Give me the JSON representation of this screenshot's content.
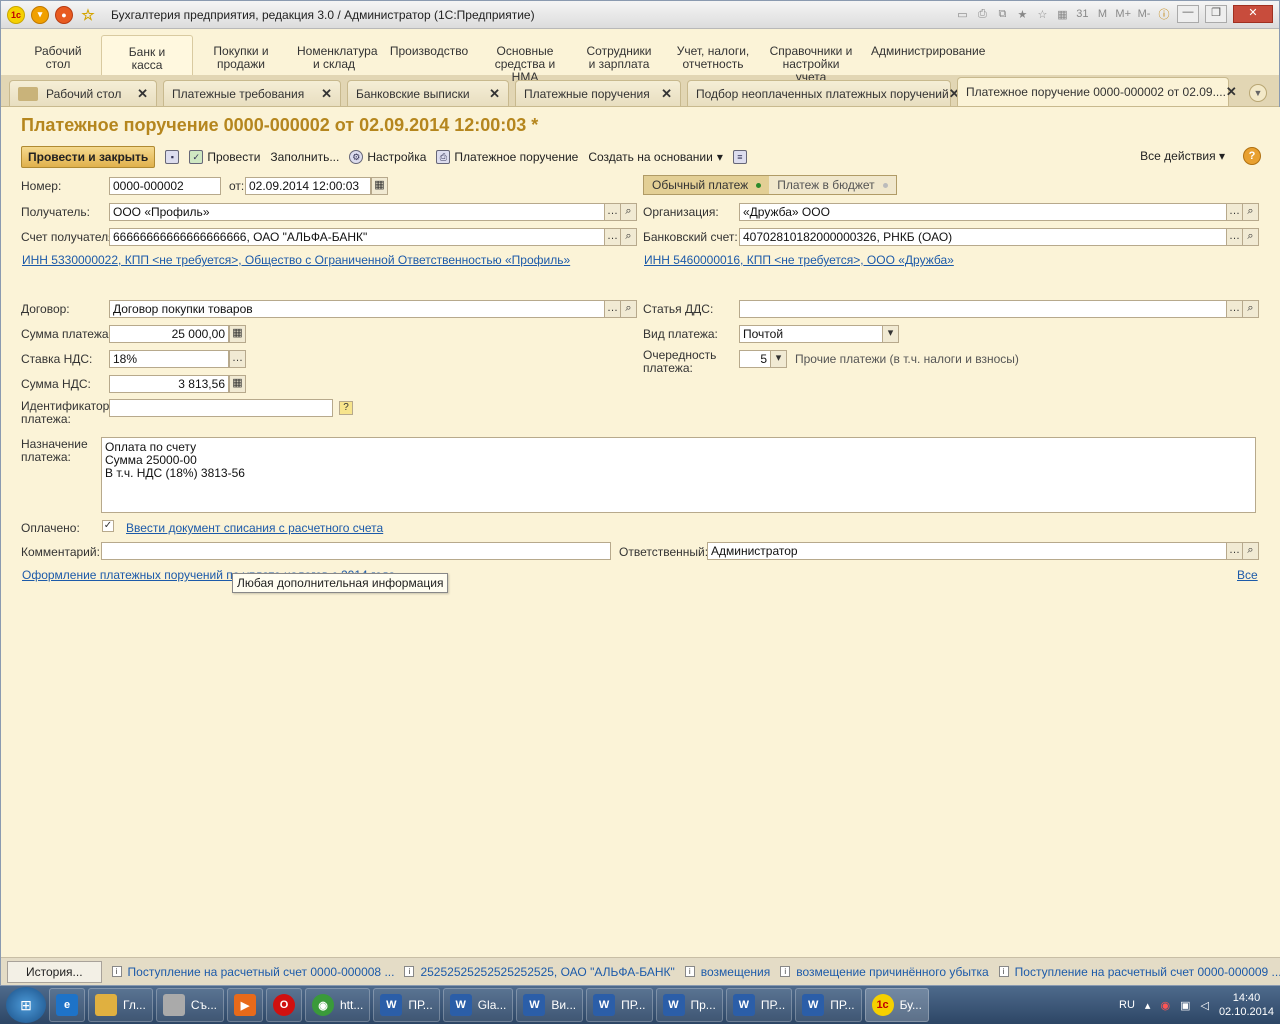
{
  "titlebar": {
    "title": "Бухгалтерия предприятия, редакция 3.0 / Администратор  (1С:Предприятие)",
    "right_icons": [
      "M",
      "M+",
      "M-"
    ]
  },
  "sections": [
    {
      "label": "Рабочий\nстол"
    },
    {
      "label": "Банк и\nкасса"
    },
    {
      "label": "Покупки и\nпродажи"
    },
    {
      "label": "Номенклатура\nи склад"
    },
    {
      "label": "Производство"
    },
    {
      "label": "Основные\nсредства и НМА"
    },
    {
      "label": "Сотрудники\nи зарплата"
    },
    {
      "label": "Учет, налоги,\nотчетность"
    },
    {
      "label": "Справочники и\nнастройки учета"
    },
    {
      "label": "Администрирование"
    }
  ],
  "tabs": [
    {
      "label": "Рабочий стол"
    },
    {
      "label": "Платежные требования"
    },
    {
      "label": "Банковские выписки"
    },
    {
      "label": "Платежные поручения"
    },
    {
      "label": "Подбор неоплаченных платежных поручений"
    },
    {
      "label": "Платежное поручение 0000-000002 от 02.09...."
    }
  ],
  "doc": {
    "title": "Платежное поручение 0000-000002 от 02.09.2014 12:00:03 *"
  },
  "toolbar": {
    "post_close": "Провести и закрыть",
    "post": "Провести",
    "fill": "Заполнить...",
    "settings": "Настройка",
    "print": "Платежное поручение",
    "create_based": "Создать на основании",
    "all_actions": "Все действия",
    "help": "?"
  },
  "fields": {
    "number_label": "Номер:",
    "number": "0000-000002",
    "date_label": "от:",
    "date": "02.09.2014 12:00:03",
    "recipient_label": "Получатель:",
    "recipient": "ООО «Профиль»",
    "recipient_acc_label": "Счет получателя:",
    "recipient_acc": "66666666666666666666, ОАО \"АЛЬФА-БАНК\"",
    "recipient_inn": "ИНН 5330000022, КПП <не требуется>, Общество с Ограниченной Ответственностью «Профиль»",
    "org_label": "Организация:",
    "org": "«Дружба» ООО",
    "bank_acc_label": "Банковский счет:",
    "bank_acc": "40702810182000000326, РНКБ (ОАО)",
    "org_inn": "ИНН 5460000016, КПП <не требуется>, ООО «Дружба»",
    "contract_label": "Договор:",
    "contract": "Договор покупки товаров",
    "dds_label": "Статья ДДС:",
    "dds": "",
    "sum_label": "Сумма платежа:",
    "sum": "25 000,00",
    "vat_rate_label": "Ставка НДС:",
    "vat_rate": "18%",
    "vat_sum_label": "Сумма НДС:",
    "vat_sum": "3 813,56",
    "pay_type_label": "Вид платежа:",
    "pay_type": "Почтой",
    "priority_label": "Очередность\nплатежа:",
    "priority": "5",
    "priority_desc": "Прочие платежи (в т.ч. налоги и взносы)",
    "pay_id_label": "Идентификатор\nплатежа:",
    "pay_id": "",
    "purpose_label": "Назначение\nплатежа:",
    "purpose": "Оплата по счету\nСумма 25000-00\nВ т.ч. НДС  (18%) 3813-56",
    "paid_label": "Оплачено:",
    "paid_link": "Ввести документ списания с расчетного счета",
    "comment_label": "Комментарий:",
    "comment": "",
    "responsible_label": "Ответственный:",
    "responsible": "Администратор",
    "bottom_link": "Оформление платежных поручений по уплате налогов с 2014 года",
    "all_link": "Все",
    "tooltip": "Любая дополнительная информация"
  },
  "toggle": {
    "normal": "Обычный платеж",
    "budget": "Платеж в бюджет"
  },
  "statusbar": {
    "history": "История...",
    "items": [
      "Поступление на расчетный счет 0000-000008 ...",
      "25252525252525252525, ОАО \"АЛЬФА-БАНК\"",
      "возмещения",
      "возмещение причинённого убытка",
      "Поступление на расчетный счет 0000-000009 ..."
    ]
  },
  "taskbar": {
    "items": [
      "Гл...",
      "Съ...",
      "",
      "",
      "htt...",
      "ПР...",
      "Gla...",
      "Ви...",
      "ПР...",
      "Пр...",
      "ПР...",
      "ПР...",
      "Бу..."
    ],
    "lang": "RU",
    "time": "14:40",
    "date": "02.10.2014"
  },
  "colors": {
    "accent": "#b5861e",
    "background": "#fbf3d7",
    "link": "#1c5aa9"
  }
}
